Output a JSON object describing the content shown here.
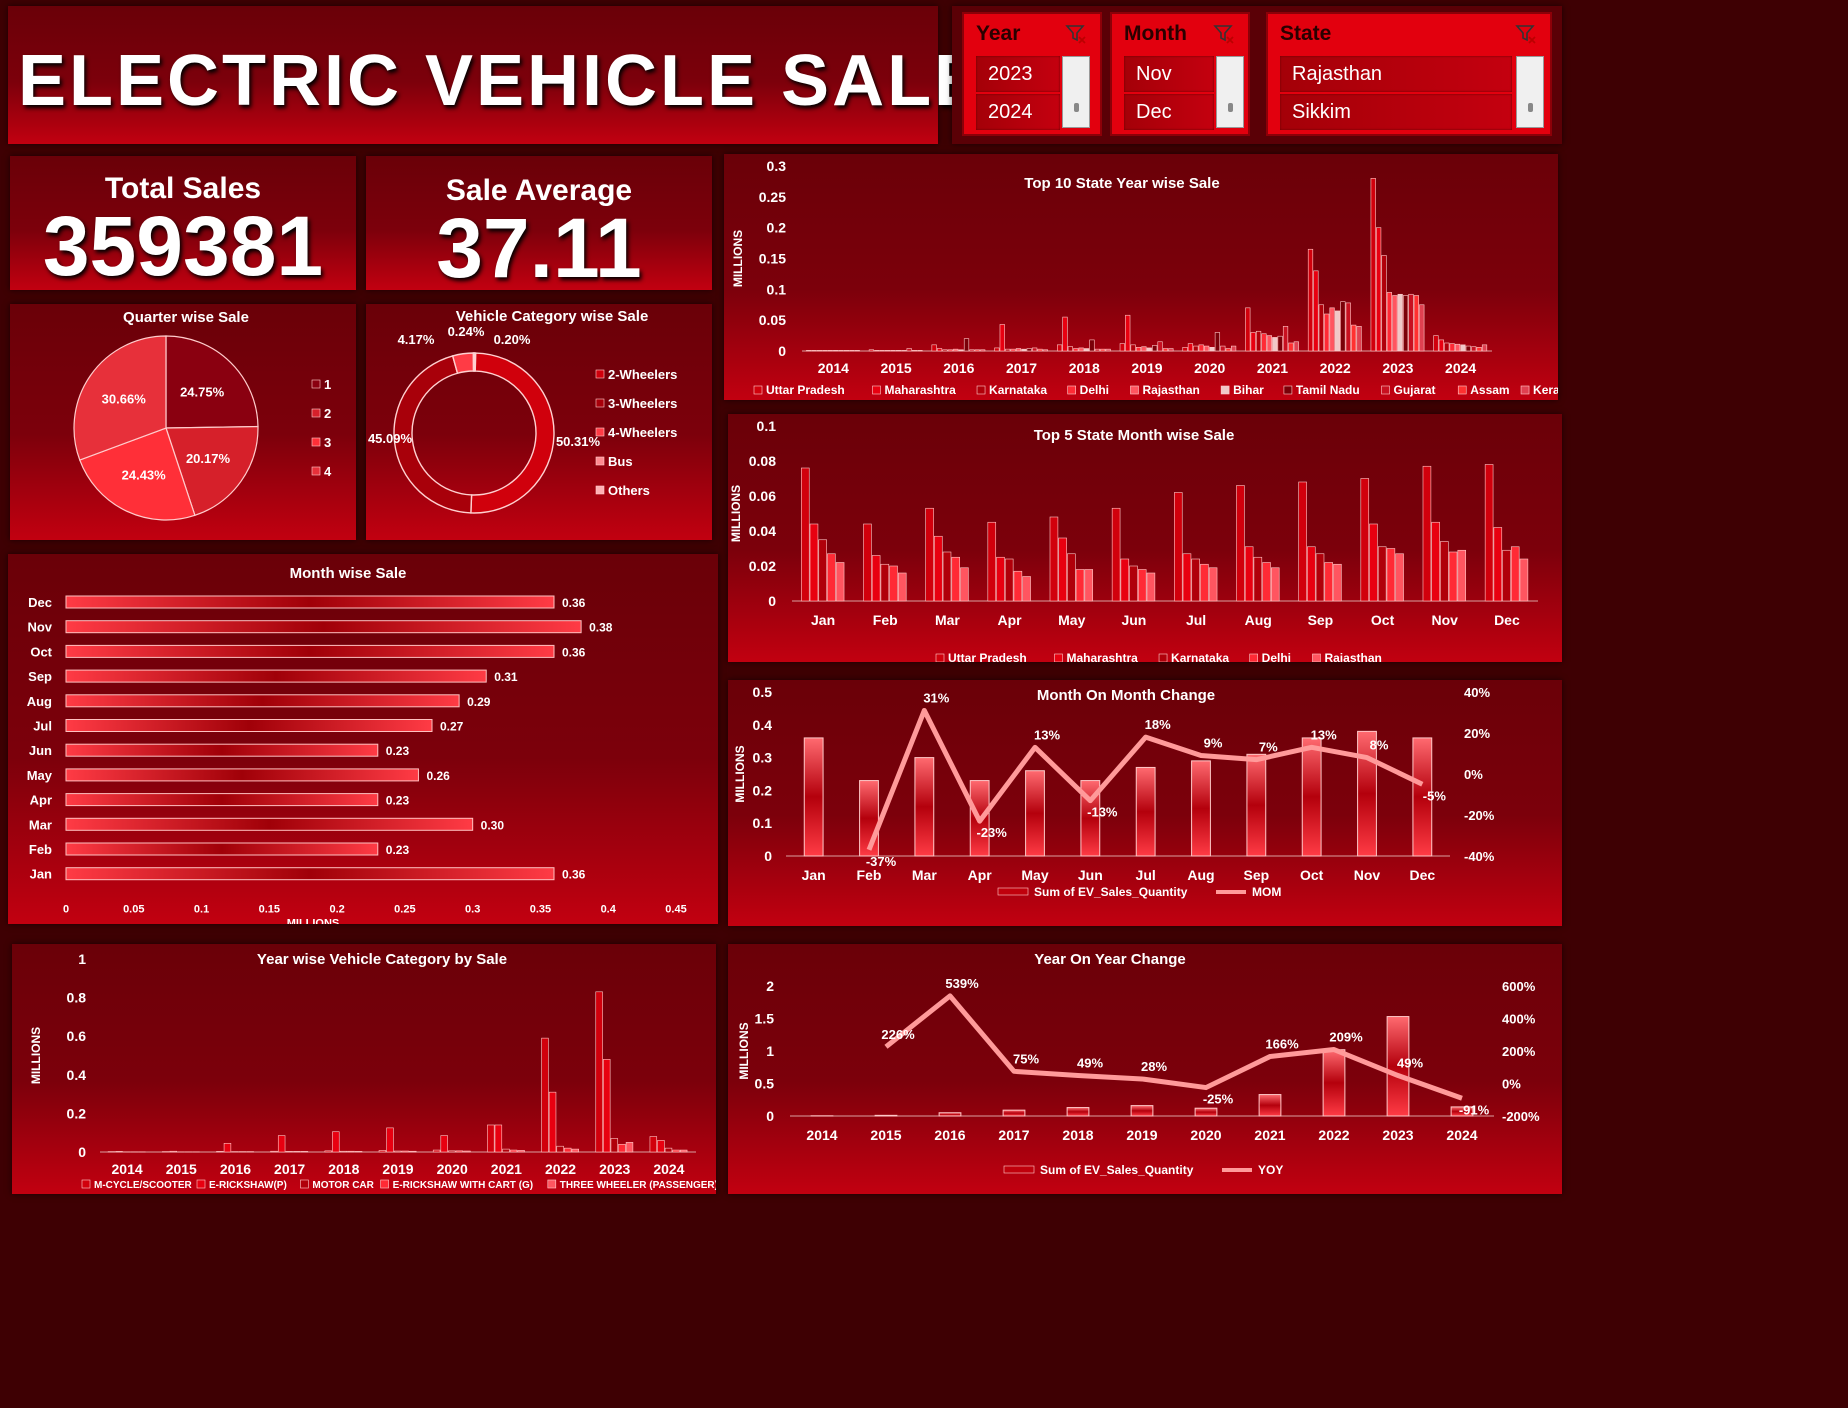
{
  "header": {
    "title": "ELECTRIC VEHICLE SALES ANALYSIS"
  },
  "slicers": [
    {
      "label": "Year",
      "selected": [
        "2023",
        "2024"
      ],
      "icon": "filter-clear-icon"
    },
    {
      "label": "Month",
      "selected": [
        "Nov",
        "Dec"
      ],
      "icon": "filter-clear-icon"
    },
    {
      "label": "State",
      "selected": [
        "Rajasthan",
        "Sikkim"
      ],
      "icon": "filter-clear-icon"
    }
  ],
  "kpis": {
    "total_sales_label": "Total Sales",
    "total_sales_value": "359381",
    "sale_average_label": "Sale Average",
    "sale_average_value": "37.11"
  },
  "colors": {
    "accent": "#e8000f",
    "background": "#3e0003",
    "line": "#ff9090"
  },
  "chart_data": [
    {
      "id": "quarter",
      "type": "pie",
      "title": "Quarter wise Sale",
      "labels": [
        "1",
        "2",
        "3",
        "4"
      ],
      "values": [
        24.75,
        20.17,
        24.43,
        30.66
      ],
      "value_labels": [
        "24.75%",
        "20.17%",
        "24.43%",
        "30.66%"
      ],
      "legend": [
        "1",
        "2",
        "3",
        "4"
      ],
      "legend_position": "right"
    },
    {
      "id": "category",
      "type": "pie",
      "title": "Vehicle Category wise Sale",
      "labels": [
        "2-Wheelers",
        "3-Wheelers",
        "4-Wheelers",
        "Bus",
        "Others"
      ],
      "values": [
        50.31,
        45.09,
        4.17,
        0.24,
        0.2
      ],
      "value_labels": [
        "50.31%",
        "45.09%",
        "4.17%",
        "0.24%",
        "0.20%"
      ],
      "legend": [
        "2-Wheelers",
        "3-Wheelers",
        "4-Wheelers",
        "Bus",
        "Others"
      ],
      "legend_position": "right"
    },
    {
      "id": "monthwise",
      "type": "bar",
      "orientation": "horizontal",
      "title": "Month wise Sale",
      "categories": [
        "Jan",
        "Feb",
        "Mar",
        "Apr",
        "May",
        "Jun",
        "Jul",
        "Aug",
        "Sep",
        "Oct",
        "Nov",
        "Dec"
      ],
      "values": [
        0.36,
        0.23,
        0.3,
        0.23,
        0.26,
        0.23,
        0.27,
        0.29,
        0.31,
        0.36,
        0.38,
        0.36
      ],
      "value_labels": [
        "0.36",
        "0.23",
        "0.30",
        "0.23",
        "0.26",
        "0.23",
        "0.27",
        "0.29",
        "0.31",
        "0.36",
        "0.38",
        "0.36"
      ],
      "xlabel": "MILLIONS",
      "xlim": [
        0,
        0.45
      ],
      "xticks": [
        "0",
        "0.05",
        "0.1",
        "0.15",
        "0.2",
        "0.25",
        "0.3",
        "0.35",
        "0.4",
        "0.45"
      ]
    },
    {
      "id": "top10",
      "type": "bar",
      "title": "Top 10 State Year wise Sale",
      "ylabel": "MILLIONS",
      "ylim": [
        0,
        0.3
      ],
      "yticks": [
        "0",
        "0.05",
        "0.1",
        "0.15",
        "0.2",
        "0.25",
        "0.3"
      ],
      "categories": [
        "2014",
        "2015",
        "2016",
        "2017",
        "2018",
        "2019",
        "2020",
        "2021",
        "2022",
        "2023",
        "2024"
      ],
      "series": [
        {
          "name": "Uttar Pradesh",
          "values": [
            0.001,
            0.002,
            0.01,
            0.005,
            0.01,
            0.012,
            0.006,
            0.07,
            0.165,
            0.28,
            0.025
          ]
        },
        {
          "name": "Maharashtra",
          "values": [
            0.001,
            0.001,
            0.004,
            0.043,
            0.055,
            0.058,
            0.012,
            0.03,
            0.13,
            0.2,
            0.018
          ]
        },
        {
          "name": "Karnataka",
          "values": [
            0.001,
            0.001,
            0.002,
            0.003,
            0.007,
            0.01,
            0.008,
            0.032,
            0.075,
            0.155,
            0.013
          ]
        },
        {
          "name": "Delhi",
          "values": [
            0.001,
            0.001,
            0.002,
            0.003,
            0.004,
            0.006,
            0.01,
            0.028,
            0.06,
            0.095,
            0.012
          ]
        },
        {
          "name": "Rajasthan",
          "values": [
            0.001,
            0.001,
            0.003,
            0.004,
            0.005,
            0.007,
            0.008,
            0.025,
            0.07,
            0.09,
            0.011
          ]
        },
        {
          "name": "Bihar",
          "values": [
            0.001,
            0.001,
            0.002,
            0.003,
            0.004,
            0.005,
            0.006,
            0.022,
            0.065,
            0.092,
            0.01
          ]
        },
        {
          "name": "Tamil Nadu",
          "values": [
            0.001,
            0.001,
            0.02,
            0.004,
            0.018,
            0.009,
            0.03,
            0.024,
            0.08,
            0.09,
            0.008
          ]
        },
        {
          "name": "Gujarat",
          "values": [
            0.001,
            0.004,
            0.002,
            0.005,
            0.003,
            0.015,
            0.008,
            0.04,
            0.078,
            0.092,
            0.007
          ]
        },
        {
          "name": "Assam",
          "values": [
            0.001,
            0.001,
            0.002,
            0.003,
            0.003,
            0.004,
            0.004,
            0.013,
            0.042,
            0.09,
            0.006
          ]
        },
        {
          "name": "Kerala",
          "values": [
            0.001,
            0.001,
            0.002,
            0.002,
            0.003,
            0.004,
            0.008,
            0.015,
            0.04,
            0.075,
            0.01
          ]
        }
      ],
      "legend_position": "bottom"
    },
    {
      "id": "top5",
      "type": "bar",
      "title": "Top 5 State Month wise Sale",
      "ylabel": "MILLIONS",
      "ylim": [
        0,
        0.1
      ],
      "yticks": [
        "0",
        "0.02",
        "0.04",
        "0.06",
        "0.08",
        "0.1"
      ],
      "categories": [
        "Jan",
        "Feb",
        "Mar",
        "Apr",
        "May",
        "Jun",
        "Jul",
        "Aug",
        "Sep",
        "Oct",
        "Nov",
        "Dec"
      ],
      "series": [
        {
          "name": "Uttar Pradesh",
          "values": [
            0.076,
            0.044,
            0.053,
            0.045,
            0.048,
            0.053,
            0.062,
            0.066,
            0.068,
            0.07,
            0.077,
            0.078
          ]
        },
        {
          "name": "Maharashtra",
          "values": [
            0.044,
            0.026,
            0.037,
            0.025,
            0.036,
            0.024,
            0.027,
            0.031,
            0.031,
            0.044,
            0.045,
            0.042
          ]
        },
        {
          "name": "Karnataka",
          "values": [
            0.035,
            0.021,
            0.028,
            0.024,
            0.027,
            0.02,
            0.024,
            0.025,
            0.027,
            0.031,
            0.034,
            0.029
          ]
        },
        {
          "name": "Delhi",
          "values": [
            0.027,
            0.02,
            0.025,
            0.017,
            0.018,
            0.018,
            0.021,
            0.022,
            0.022,
            0.03,
            0.028,
            0.031
          ]
        },
        {
          "name": "Rajasthan",
          "values": [
            0.022,
            0.016,
            0.019,
            0.014,
            0.018,
            0.016,
            0.019,
            0.019,
            0.021,
            0.027,
            0.029,
            0.024
          ]
        }
      ],
      "legend_position": "bottom"
    },
    {
      "id": "mom",
      "type": "bar",
      "title": "Month On Month Change",
      "ylabel": "MILLIONS",
      "ylim": [
        0,
        0.5
      ],
      "yticks": [
        "0",
        "0.1",
        "0.2",
        "0.3",
        "0.4",
        "0.5"
      ],
      "y2lim": [
        -40,
        40
      ],
      "y2ticks": [
        "-40%",
        "-20%",
        "0%",
        "20%",
        "40%"
      ],
      "categories": [
        "Jan",
        "Feb",
        "Mar",
        "Apr",
        "May",
        "Jun",
        "Jul",
        "Aug",
        "Sep",
        "Oct",
        "Nov",
        "Dec"
      ],
      "series": [
        {
          "name": "Sum of EV_Sales_Quantity",
          "type": "bar",
          "values": [
            0.36,
            0.23,
            0.3,
            0.23,
            0.26,
            0.23,
            0.27,
            0.29,
            0.31,
            0.36,
            0.38,
            0.36
          ]
        },
        {
          "name": "MOM",
          "type": "line",
          "axis": "secondary",
          "values": [
            null,
            -37,
            31,
            -23,
            13,
            -13,
            18,
            9,
            7,
            13,
            8,
            -5
          ],
          "labels": [
            "",
            "-37%",
            "31%",
            "-23%",
            "13%",
            "-13%",
            "18%",
            "9%",
            "7%",
            "13%",
            "8%",
            "-5%"
          ]
        }
      ],
      "legend_position": "bottom"
    },
    {
      "id": "yearcat",
      "type": "bar",
      "title": "Year wise Vehicle Category by Sale",
      "ylabel": "MILLIONS",
      "ylim": [
        0,
        1
      ],
      "yticks": [
        "0",
        "0.2",
        "0.4",
        "0.6",
        "0.8",
        "1"
      ],
      "categories": [
        "2014",
        "2015",
        "2016",
        "2017",
        "2018",
        "2019",
        "2020",
        "2021",
        "2022",
        "2023",
        "2024"
      ],
      "series": [
        {
          "name": "M-CYCLE/SCOOTER",
          "values": [
            0.002,
            0.002,
            0.003,
            0.004,
            0.006,
            0.008,
            0.01,
            0.14,
            0.59,
            0.83,
            0.08
          ]
        },
        {
          "name": "E-RICKSHAW(P)",
          "values": [
            0.003,
            0.004,
            0.045,
            0.085,
            0.105,
            0.125,
            0.085,
            0.14,
            0.31,
            0.48,
            0.06
          ]
        },
        {
          "name": "MOTOR CAR",
          "values": [
            0.001,
            0.001,
            0.002,
            0.003,
            0.004,
            0.005,
            0.006,
            0.015,
            0.03,
            0.07,
            0.02
          ]
        },
        {
          "name": "E-RICKSHAW WITH CART (G)",
          "values": [
            0.001,
            0.001,
            0.002,
            0.003,
            0.004,
            0.005,
            0.006,
            0.01,
            0.02,
            0.04,
            0.01
          ]
        },
        {
          "name": "THREE WHEELER (PASSENGER)",
          "values": [
            0.001,
            0.001,
            0.002,
            0.003,
            0.003,
            0.004,
            0.005,
            0.008,
            0.015,
            0.05,
            0.01
          ]
        }
      ],
      "legend_position": "bottom"
    },
    {
      "id": "yoy",
      "type": "bar",
      "title": "Year On Year Change",
      "ylabel": "MILLIONS",
      "ylim": [
        0,
        2
      ],
      "yticks": [
        "0",
        "0.5",
        "1",
        "1.5",
        "2"
      ],
      "y2lim": [
        -200,
        600
      ],
      "y2ticks": [
        "-200%",
        "0%",
        "200%",
        "400%",
        "600%"
      ],
      "categories": [
        "2014",
        "2015",
        "2016",
        "2017",
        "2018",
        "2019",
        "2020",
        "2021",
        "2022",
        "2023",
        "2024"
      ],
      "series": [
        {
          "name": "Sum of EV_Sales_Quantity",
          "type": "bar",
          "values": [
            0.003,
            0.01,
            0.05,
            0.09,
            0.13,
            0.16,
            0.12,
            0.33,
            1.02,
            1.53,
            0.14
          ]
        },
        {
          "name": "YOY",
          "type": "line",
          "axis": "secondary",
          "values": [
            null,
            226,
            539,
            75,
            49,
            28,
            -25,
            166,
            209,
            49,
            -91
          ],
          "labels": [
            "",
            "226%",
            "539%",
            "75%",
            "49%",
            "28%",
            "-25%",
            "166%",
            "209%",
            "49%",
            "-91%"
          ]
        }
      ],
      "legend_position": "bottom"
    }
  ]
}
